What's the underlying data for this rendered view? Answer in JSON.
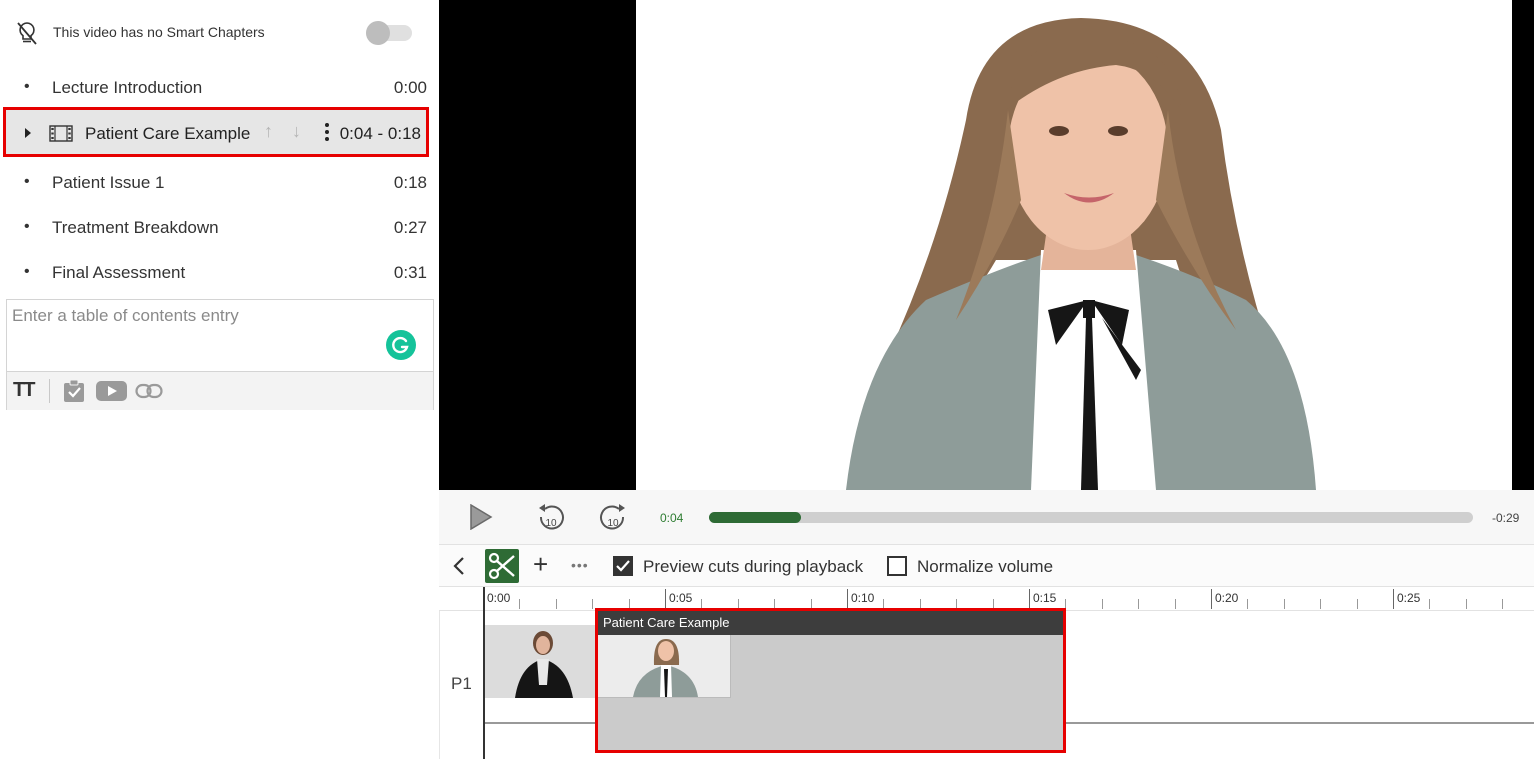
{
  "smart_chapters": {
    "text": "This video has no Smart Chapters",
    "enabled": false
  },
  "toc": {
    "items": [
      {
        "bullet": "•",
        "label": "Lecture Introduction",
        "time": "0:00"
      },
      {
        "label": "Patient Care Example",
        "time": "0:04 - 0:18",
        "selected": true,
        "up_arrow": "↑",
        "down_arrow": "↓"
      },
      {
        "bullet": "•",
        "label": "Patient Issue 1",
        "time": "0:18"
      },
      {
        "bullet": "•",
        "label": "Treatment Breakdown",
        "time": "0:27"
      },
      {
        "bullet": "•",
        "label": "Final Assessment",
        "time": "0:31"
      }
    ],
    "entry_placeholder": "Enter a table of contents entry",
    "toolbar": {
      "text_format_glyph": "TT",
      "icons": [
        "quiz-check-icon",
        "youtube-icon",
        "link-icon"
      ]
    }
  },
  "player": {
    "current_time": "0:04",
    "remaining_time": "-0:29",
    "progress": 0.12,
    "skip_back_label": "10",
    "skip_forward_label": "10"
  },
  "editor": {
    "plus": "+",
    "more": "•••",
    "preview_cuts": {
      "label": "Preview cuts during playback",
      "checked": true
    },
    "normalize_volume": {
      "label": "Normalize volume",
      "checked": false
    }
  },
  "timeline": {
    "tick_labels": [
      "0:00",
      "0:05",
      "0:10",
      "0:15",
      "0:20",
      "0:25"
    ],
    "track_label": "P1",
    "clips": [
      {
        "title": ""
      },
      {
        "title": "Patient Care Example",
        "selected": true
      }
    ]
  },
  "colors": {
    "accent_green": "#2e6b35",
    "highlight_red": "#e60000",
    "grammarly": "#15c39a"
  }
}
